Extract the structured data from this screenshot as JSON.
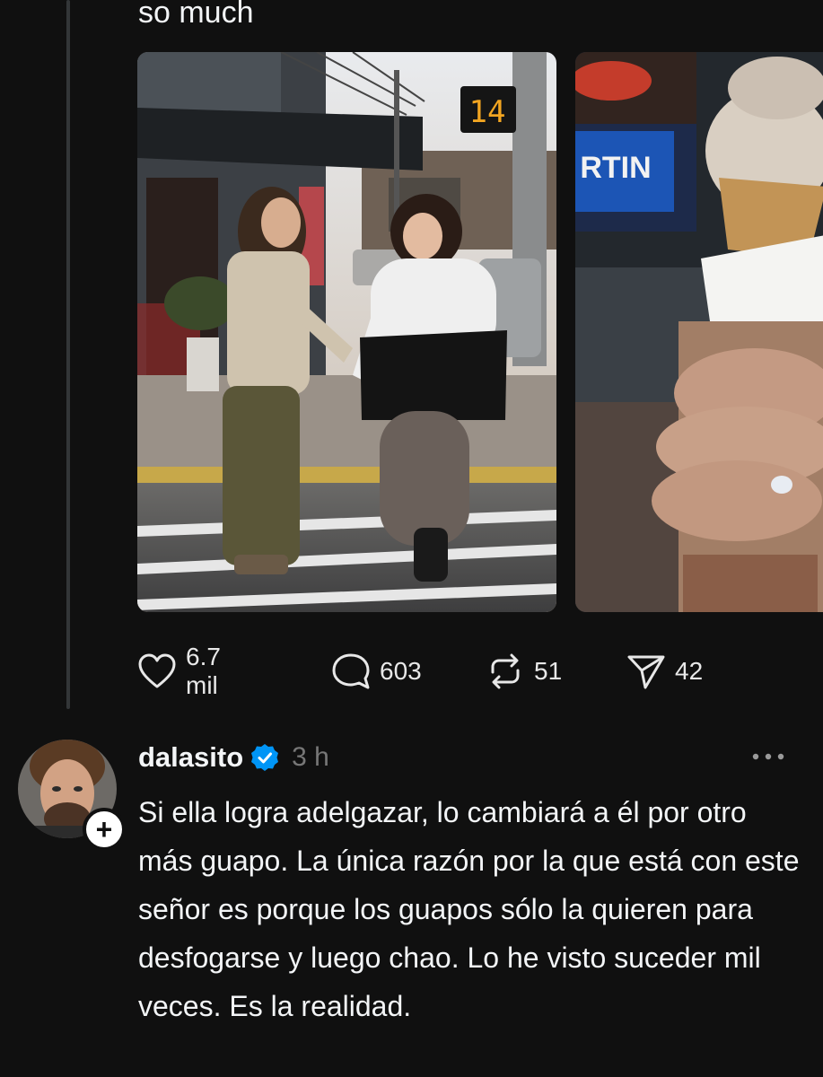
{
  "post": {
    "text_tail": "so much",
    "media": [
      {
        "icon": "couple-crosswalk-photo"
      },
      {
        "icon": "ice-cream-ring-photo",
        "sign_text": "RTIN",
        "timer_text": "14"
      }
    ],
    "actions": {
      "likes": {
        "icon": "heart-icon",
        "count": "6.7 mil"
      },
      "replies": {
        "icon": "comment-icon",
        "count": "603"
      },
      "reposts": {
        "icon": "repost-icon",
        "count": "51"
      },
      "shares": {
        "icon": "send-icon",
        "count": "42"
      }
    }
  },
  "reply": {
    "username": "dalasito",
    "verified": true,
    "time": "3 h",
    "follow_symbol": "+",
    "text": "Si ella logra adelgazar, lo cambiará a él por otro más guapo. La única razón por la que está con este señor es porque los guapos sólo la quieren para desfogarse y luego chao. Lo he visto suceder mil veces. Es la realidad.",
    "more_icon": "more-dots-icon"
  },
  "colors": {
    "background": "#101010",
    "text": "#f3f5f7",
    "secondary_text": "#777777",
    "thread_line": "#333638",
    "verified_badge": "#0095f6"
  }
}
